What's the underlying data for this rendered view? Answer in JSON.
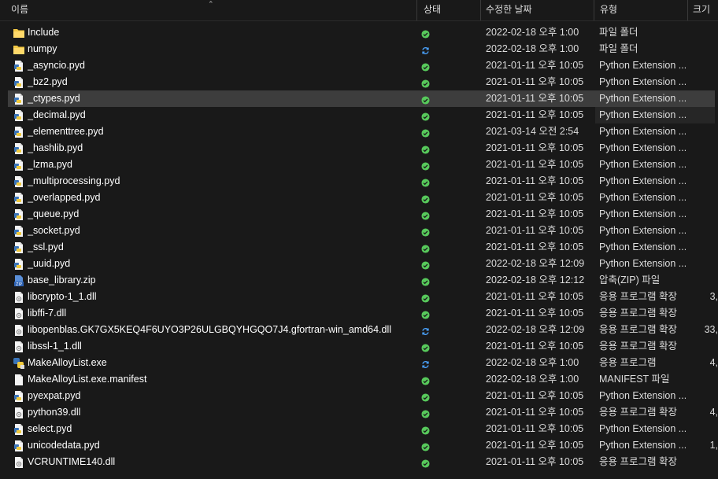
{
  "columns": {
    "name": "이름",
    "status": "상태",
    "date": "수정한 날짜",
    "type": "유형",
    "size": "크기"
  },
  "colors": {
    "background": "#191919",
    "selected_row": "#3d3d3d",
    "synced_green": "#57c95b",
    "syncing_blue": "#4aa3ff",
    "folder_yellow": "#f2c744"
  },
  "files": [
    {
      "name": "Include",
      "icon": "folder-icon",
      "status": "synced",
      "date": "2022-02-18 오후 1:00",
      "type": "파일 폴더",
      "size": ""
    },
    {
      "name": "numpy",
      "icon": "folder-icon",
      "status": "syncing",
      "date": "2022-02-18 오후 1:00",
      "type": "파일 폴더",
      "size": ""
    },
    {
      "name": "_asyncio.pyd",
      "icon": "python-file-icon",
      "status": "synced",
      "date": "2021-01-11 오후 10:05",
      "type": "Python Extension ...",
      "size": ""
    },
    {
      "name": "_bz2.pyd",
      "icon": "python-file-icon",
      "status": "synced",
      "date": "2021-01-11 오후 10:05",
      "type": "Python Extension ...",
      "size": ""
    },
    {
      "name": "_ctypes.pyd",
      "icon": "python-file-icon",
      "status": "synced",
      "date": "2021-01-11 오후 10:05",
      "type": "Python Extension ...",
      "size": "",
      "selected": true
    },
    {
      "name": "_decimal.pyd",
      "icon": "python-file-icon",
      "status": "synced",
      "date": "2021-01-11 오후 10:05",
      "type": "Python Extension ...",
      "size": "",
      "trail": true
    },
    {
      "name": "_elementtree.pyd",
      "icon": "python-file-icon",
      "status": "synced",
      "date": "2021-03-14 오전 2:54",
      "type": "Python Extension ...",
      "size": ""
    },
    {
      "name": "_hashlib.pyd",
      "icon": "python-file-icon",
      "status": "synced",
      "date": "2021-01-11 오후 10:05",
      "type": "Python Extension ...",
      "size": ""
    },
    {
      "name": "_lzma.pyd",
      "icon": "python-file-icon",
      "status": "synced",
      "date": "2021-01-11 오후 10:05",
      "type": "Python Extension ...",
      "size": ""
    },
    {
      "name": "_multiprocessing.pyd",
      "icon": "python-file-icon",
      "status": "synced",
      "date": "2021-01-11 오후 10:05",
      "type": "Python Extension ...",
      "size": ""
    },
    {
      "name": "_overlapped.pyd",
      "icon": "python-file-icon",
      "status": "synced",
      "date": "2021-01-11 오후 10:05",
      "type": "Python Extension ...",
      "size": ""
    },
    {
      "name": "_queue.pyd",
      "icon": "python-file-icon",
      "status": "synced",
      "date": "2021-01-11 오후 10:05",
      "type": "Python Extension ...",
      "size": ""
    },
    {
      "name": "_socket.pyd",
      "icon": "python-file-icon",
      "status": "synced",
      "date": "2021-01-11 오후 10:05",
      "type": "Python Extension ...",
      "size": ""
    },
    {
      "name": "_ssl.pyd",
      "icon": "python-file-icon",
      "status": "synced",
      "date": "2021-01-11 오후 10:05",
      "type": "Python Extension ...",
      "size": ""
    },
    {
      "name": "_uuid.pyd",
      "icon": "python-file-icon",
      "status": "synced",
      "date": "2022-02-18 오후 12:09",
      "type": "Python Extension ...",
      "size": ""
    },
    {
      "name": "base_library.zip",
      "icon": "zip-file-icon",
      "status": "synced",
      "date": "2022-02-18 오후 12:12",
      "type": "압축(ZIP) 파일",
      "size": ""
    },
    {
      "name": "libcrypto-1_1.dll",
      "icon": "dll-file-icon",
      "status": "synced",
      "date": "2021-01-11 오후 10:05",
      "type": "응용 프로그램 확장",
      "size": "3,"
    },
    {
      "name": "libffi-7.dll",
      "icon": "dll-file-icon",
      "status": "synced",
      "date": "2021-01-11 오후 10:05",
      "type": "응용 프로그램 확장",
      "size": ""
    },
    {
      "name": "libopenblas.GK7GX5KEQ4F6UYO3P26ULGBQYHGQO7J4.gfortran-win_amd64.dll",
      "icon": "dll-file-icon",
      "status": "syncing",
      "date": "2022-02-18 오후 12:09",
      "type": "응용 프로그램 확장",
      "size": "33,"
    },
    {
      "name": "libssl-1_1.dll",
      "icon": "dll-file-icon",
      "status": "synced",
      "date": "2021-01-11 오후 10:05",
      "type": "응용 프로그램 확장",
      "size": ""
    },
    {
      "name": "MakeAlloyList.exe",
      "icon": "python-exe-icon",
      "status": "syncing",
      "date": "2022-02-18 오후 1:00",
      "type": "응용 프로그램",
      "size": "4,"
    },
    {
      "name": "MakeAlloyList.exe.manifest",
      "icon": "generic-file-icon",
      "status": "synced",
      "date": "2022-02-18 오후 1:00",
      "type": "MANIFEST 파일",
      "size": ""
    },
    {
      "name": "pyexpat.pyd",
      "icon": "python-file-icon",
      "status": "synced",
      "date": "2021-01-11 오후 10:05",
      "type": "Python Extension ...",
      "size": ""
    },
    {
      "name": "python39.dll",
      "icon": "dll-file-icon",
      "status": "synced",
      "date": "2021-01-11 오후 10:05",
      "type": "응용 프로그램 확장",
      "size": "4,"
    },
    {
      "name": "select.pyd",
      "icon": "python-file-icon",
      "status": "synced",
      "date": "2021-01-11 오후 10:05",
      "type": "Python Extension ...",
      "size": ""
    },
    {
      "name": "unicodedata.pyd",
      "icon": "python-file-icon",
      "status": "synced",
      "date": "2021-01-11 오후 10:05",
      "type": "Python Extension ...",
      "size": "1,"
    },
    {
      "name": "VCRUNTIME140.dll",
      "icon": "dll-file-icon",
      "status": "synced",
      "date": "2021-01-11 오후 10:05",
      "type": "응용 프로그램 확장",
      "size": ""
    }
  ]
}
